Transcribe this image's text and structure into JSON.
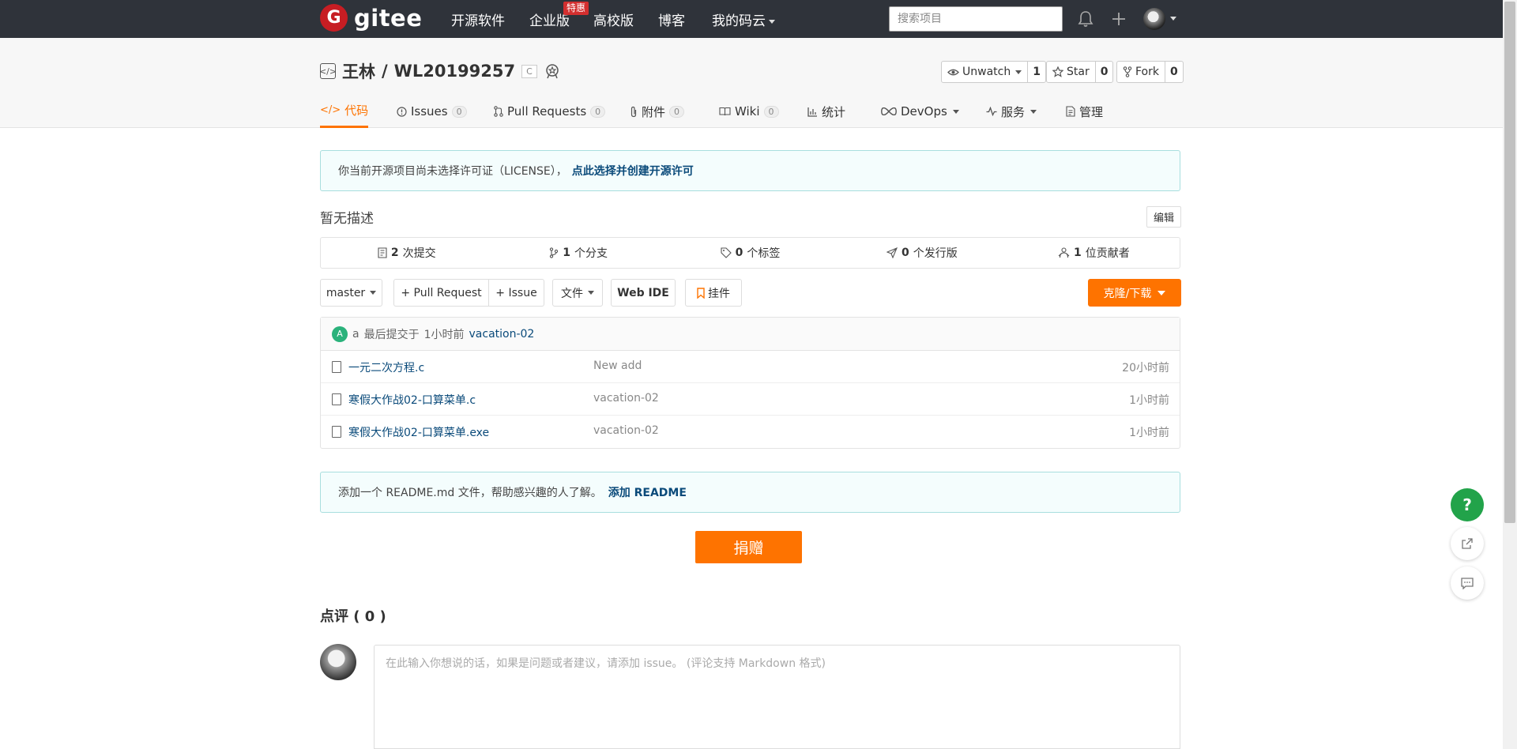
{
  "nav": {
    "logo_text": "gitee",
    "logo_letter": "G",
    "items": [
      "开源软件",
      "企业版",
      "高校版",
      "博客",
      "我的码云"
    ],
    "badge": "特惠",
    "search_placeholder": "搜索项目"
  },
  "repo": {
    "owner": "王林",
    "separator": "/",
    "name": "WL20199257",
    "language": "C",
    "watch": {
      "label": "Unwatch",
      "count": "1"
    },
    "star": {
      "label": "Star",
      "count": "0"
    },
    "fork": {
      "label": "Fork",
      "count": "0"
    }
  },
  "tabs": [
    {
      "label": "代码",
      "count": ""
    },
    {
      "label": "Issues",
      "count": "0"
    },
    {
      "label": "Pull Requests",
      "count": "0"
    },
    {
      "label": "附件",
      "count": "0"
    },
    {
      "label": "Wiki",
      "count": "0"
    },
    {
      "label": "统计",
      "count": ""
    },
    {
      "label": "DevOps",
      "count": ""
    },
    {
      "label": "服务",
      "count": ""
    },
    {
      "label": "管理",
      "count": ""
    }
  ],
  "license_notice": {
    "text": "你当前开源项目尚未选择许可证（LICENSE），",
    "link": "点此选择并创建开源许可"
  },
  "description": "暂无描述",
  "edit_label": "编辑",
  "stats": [
    {
      "num": "2",
      "label": "次提交"
    },
    {
      "num": "1",
      "label": "个分支"
    },
    {
      "num": "0",
      "label": "个标签"
    },
    {
      "num": "0",
      "label": "个发行版"
    },
    {
      "num": "1",
      "label": "位贡献者"
    }
  ],
  "toolbar": {
    "branch": "master",
    "pull_request": "+ Pull Request",
    "issue": "+ Issue",
    "file": "文件",
    "web_ide": "Web IDE",
    "widget": "挂件",
    "clone": "克隆/下载"
  },
  "last_commit": {
    "avatar_letter": "A",
    "author": "a",
    "text": "最后提交于",
    "time": "1小时前",
    "message": "vacation-02"
  },
  "files": [
    {
      "name": "一元二次方程.c",
      "message": "New add",
      "time": "20小时前"
    },
    {
      "name": "寒假大作战02-口算菜单.c",
      "message": "vacation-02",
      "time": "1小时前"
    },
    {
      "name": "寒假大作战02-口算菜单.exe",
      "message": "vacation-02",
      "time": "1小时前"
    }
  ],
  "readme_notice": {
    "text": "添加一个 README.md 文件，帮助感兴趣的人了解。",
    "link": "添加 README"
  },
  "donate_label": "捐赠",
  "comments": {
    "title": "点评 ( 0 )",
    "placeholder": "在此输入你想说的话，如果是问题或者建议，请添加 issue。 (评论支持 Markdown 格式)"
  },
  "help_label": "?",
  "colors": {
    "accent": "#fe7300",
    "nav_bg": "#2f333a",
    "link": "#0a4a7a",
    "help_green": "#22a34a"
  }
}
